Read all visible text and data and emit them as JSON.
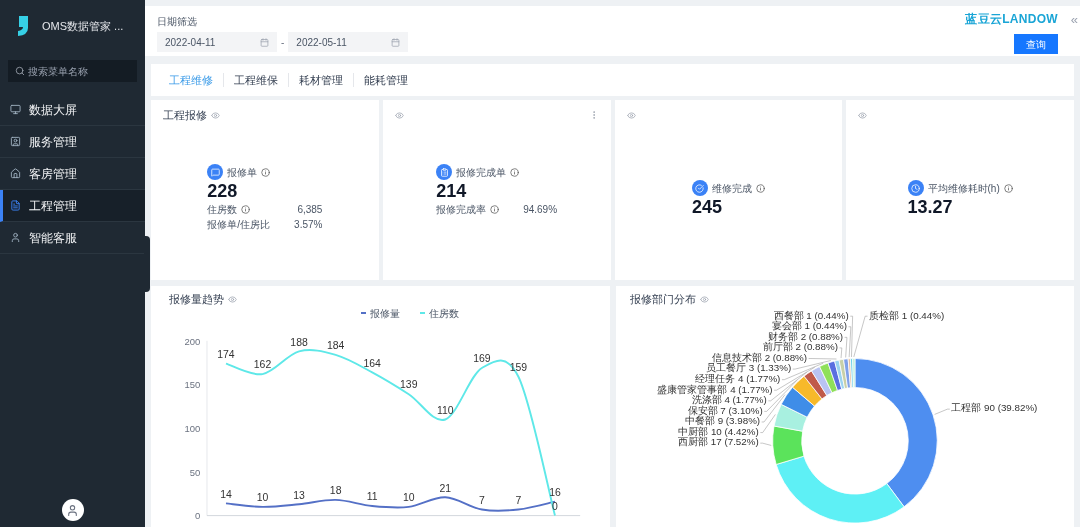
{
  "sidebar": {
    "app_title": "OMS数据管家 ...",
    "search": {
      "placeholder": "搜索菜单名称"
    },
    "items": [
      {
        "label": "数据大屏",
        "selected": false
      },
      {
        "label": "服务管理",
        "selected": false
      },
      {
        "label": "客房管理",
        "selected": false
      },
      {
        "label": "工程管理",
        "selected": true
      },
      {
        "label": "智能客服",
        "selected": false
      }
    ]
  },
  "filter": {
    "label": "日期筛选",
    "start_date": "2022-04-11",
    "separator": "-",
    "end_date": "2022-05-11",
    "query_button": "查询",
    "brand": "蓝豆云LANDOW",
    "collapse": "«"
  },
  "tabs": [
    {
      "label": "工程维修",
      "selected": true
    },
    {
      "label": "工程维保",
      "selected": false
    },
    {
      "label": "耗材管理",
      "selected": false
    },
    {
      "label": "能耗管理",
      "selected": false
    }
  ],
  "kpi_cards": [
    {
      "title": "工程报修",
      "menu": false,
      "label": "报修单",
      "value": "228",
      "details": [
        {
          "label": "住房数",
          "info": true,
          "value": "6,385"
        },
        {
          "label": "报修单/住房比",
          "info": false,
          "value": "3.57%"
        }
      ]
    },
    {
      "menu": true,
      "label": "报修完成单",
      "value": "214",
      "details": [
        {
          "label": "报修完成率",
          "info": true,
          "value": "94.69%"
        }
      ]
    },
    {
      "menu": false,
      "label": "维修完成",
      "value": "245"
    },
    {
      "menu": false,
      "label": "平均维修耗时(h)",
      "value": "13.27"
    }
  ],
  "trend": {
    "title": "报修量趋势",
    "chart_data": {
      "type": "line",
      "ylim": [
        0,
        200
      ],
      "yticks": [
        0,
        50,
        100,
        150,
        200
      ],
      "data_labels": true,
      "series": [
        {
          "name": "报修量",
          "color": "#5470c6",
          "values": [
            14,
            10,
            13,
            18,
            11,
            10,
            21,
            7,
            7,
            16
          ]
        },
        {
          "name": "住房数",
          "color": "#5ee8e8",
          "values": [
            174,
            162,
            188,
            184,
            164,
            139,
            110,
            169,
            159,
            0
          ]
        }
      ]
    }
  },
  "distribution": {
    "title": "报修部门分布",
    "chart_data": {
      "type": "donut",
      "categories": [
        "工程部",
        null,
        "西厨部",
        "中厨部",
        "中餐部",
        "保安部",
        "洗涤部",
        "盛康管家管事部",
        "经理任务",
        "员工餐厅",
        "信息技术部",
        "前厅部",
        "财务部",
        "宴会部",
        "西餐部",
        "质检部"
      ],
      "values": [
        90,
        69,
        17,
        10,
        9,
        7,
        4,
        4,
        4,
        3,
        2,
        2,
        2,
        1,
        1,
        1
      ],
      "value_labels": [
        "90 (39.82%)",
        null,
        "17 (7.52%)",
        "10 (4.42%)",
        "9 (3.98%)",
        "7 (3.10%)",
        "4 (1.77%)",
        "4 (1.77%)",
        "4 (1.77%)",
        "3 (1.33%)",
        "2 (0.88%)",
        "2 (0.88%)",
        "2 (0.88%)",
        "1 (0.44%)",
        "1 (0.44%)",
        "1 (0.44%)"
      ]
    }
  }
}
